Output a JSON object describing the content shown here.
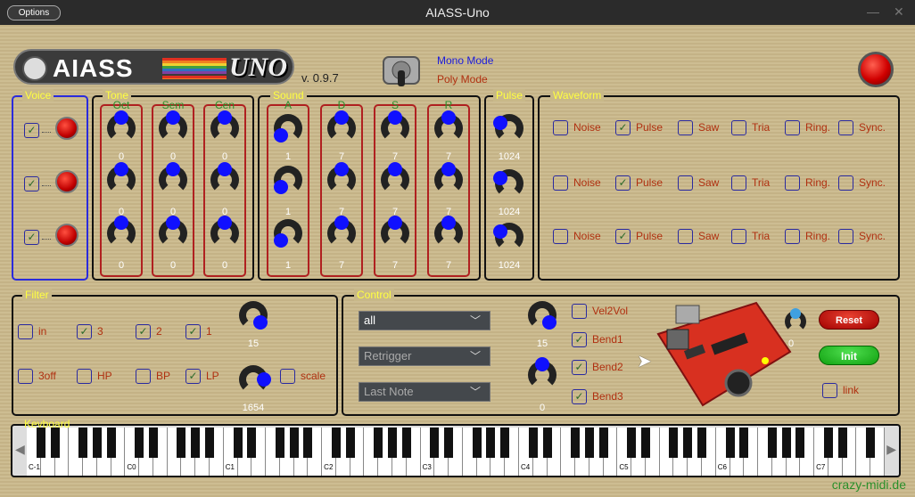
{
  "window": {
    "title": "AIASS-Uno",
    "options_label": "Options",
    "minimize_glyph": "—",
    "close_glyph": "✕"
  },
  "header": {
    "logo_text": "AIASS",
    "logo_text2": "UNO",
    "version": "v. 0.9.7",
    "mode1": "Mono Mode",
    "mode2": "Poly Mode"
  },
  "voice": {
    "label": "Voice",
    "rows": [
      {
        "checked": true
      },
      {
        "checked": true
      },
      {
        "checked": true
      }
    ]
  },
  "tone": {
    "label": "Tone",
    "cols": [
      "Oct",
      "Sem",
      "Cen"
    ],
    "values": [
      [
        "0",
        "0",
        "0"
      ],
      [
        "0",
        "0",
        "0"
      ],
      [
        "0",
        "0",
        "0"
      ]
    ]
  },
  "sound": {
    "label": "Sound",
    "cols": [
      "A",
      "D",
      "S",
      "R"
    ],
    "values": [
      [
        "1",
        "7",
        "7",
        "7"
      ],
      [
        "1",
        "7",
        "7",
        "7"
      ],
      [
        "1",
        "7",
        "7",
        "7"
      ]
    ]
  },
  "pulse": {
    "label": "Pulse",
    "values": [
      "1024",
      "1024",
      "1024"
    ]
  },
  "waveform": {
    "label": "Waveform",
    "options": [
      "Noise",
      "Pulse",
      "Saw",
      "Tria",
      "Ring.",
      "Sync."
    ],
    "checked": [
      [
        false,
        true,
        false,
        false,
        false,
        false
      ],
      [
        false,
        true,
        false,
        false,
        false,
        false
      ],
      [
        false,
        true,
        false,
        false,
        false,
        false
      ]
    ]
  },
  "filter": {
    "label": "Filter",
    "row1": [
      {
        "label": "in",
        "checked": false
      },
      {
        "label": "3",
        "checked": true
      },
      {
        "label": "2",
        "checked": true
      },
      {
        "label": "1",
        "checked": true
      }
    ],
    "row2": [
      {
        "label": "3off",
        "checked": false
      },
      {
        "label": "HP",
        "checked": false
      },
      {
        "label": "BP",
        "checked": false
      },
      {
        "label": "LP",
        "checked": true
      }
    ],
    "knob1_value": "15",
    "knob2_value": "1654",
    "scale_label": "scale"
  },
  "control": {
    "label": "Control",
    "combo1": "all",
    "combo2": "Retrigger",
    "combo3": "Last Note",
    "knob1_value": "15",
    "knob2_value": "0",
    "checks": [
      {
        "label": "Vel2Vol",
        "checked": false
      },
      {
        "label": "Bend1",
        "checked": true
      },
      {
        "label": "Bend2",
        "checked": true
      },
      {
        "label": "Bend3",
        "checked": true
      }
    ],
    "knob3_value": "0",
    "reset_label": "Reset",
    "init_label": "Init",
    "link_label": "link"
  },
  "keyboard": {
    "label": "Keyboard",
    "octaves": [
      "C-1",
      "C0",
      "C1",
      "C2",
      "C3",
      "C4",
      "C5",
      "C6",
      "C7"
    ]
  },
  "footer": "crazy-midi.de",
  "colors": {
    "accent_yellow": "#ffff40",
    "label_red": "#b03010",
    "label_green": "#2a8f2a",
    "knob_blue": "#1010ff"
  }
}
